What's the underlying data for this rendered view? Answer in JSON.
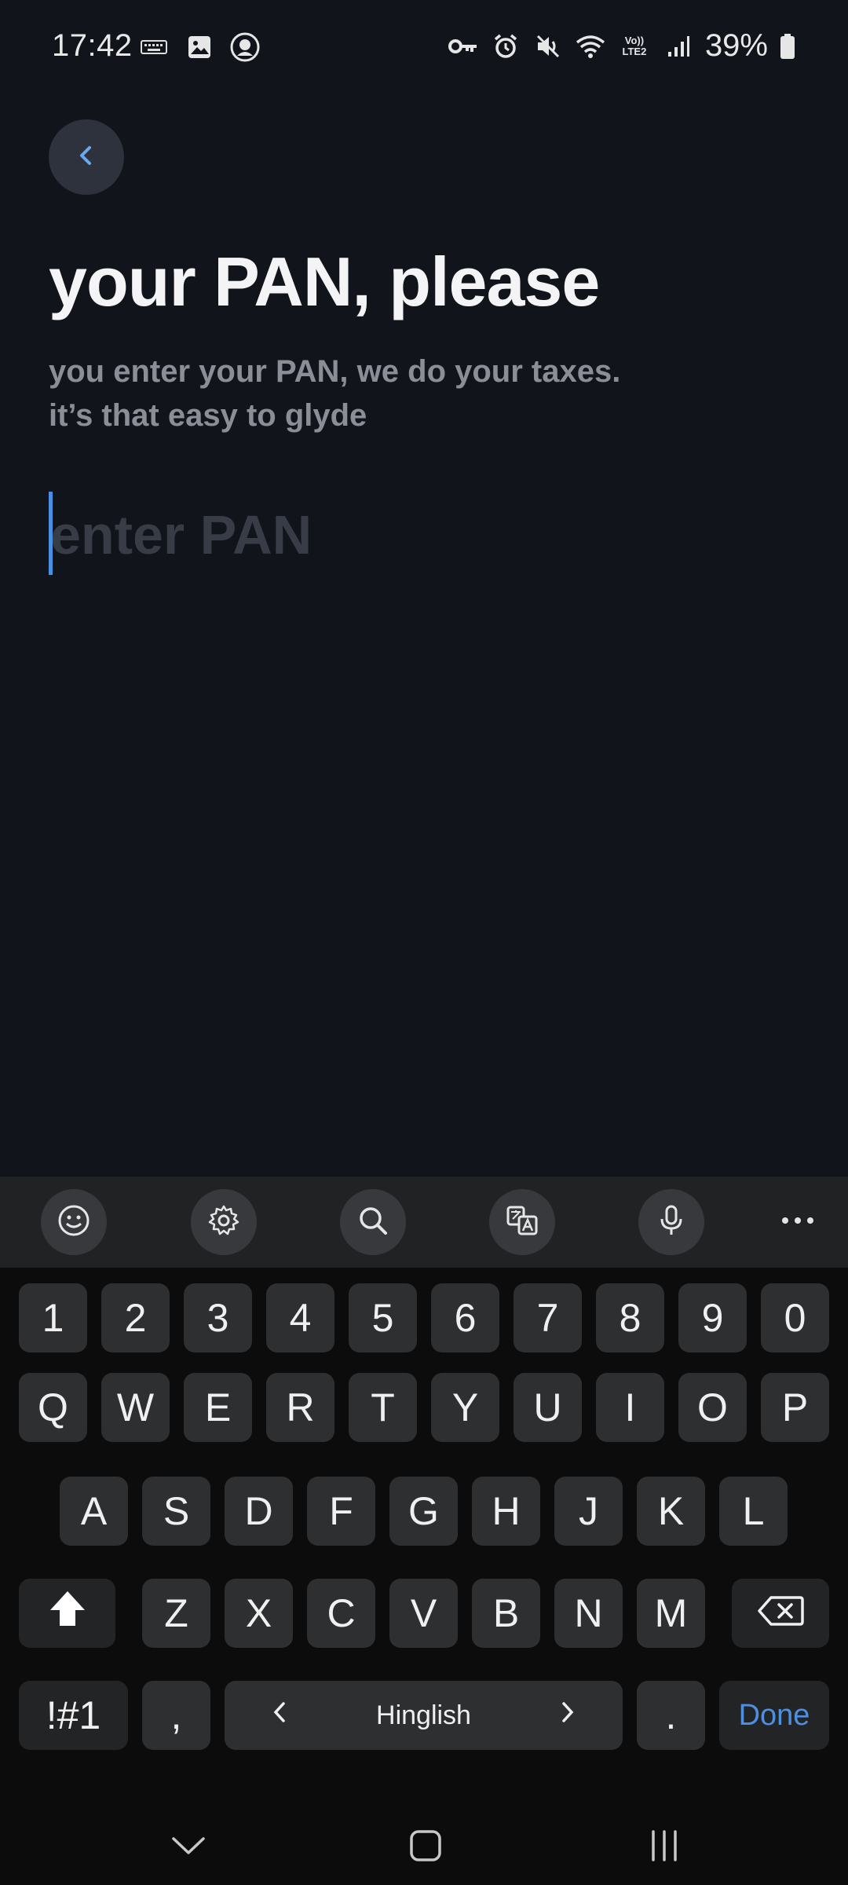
{
  "status_bar": {
    "time": "17:42",
    "battery_percent": "39%",
    "left_icons": [
      "keyboard-icon",
      "image-icon",
      "app-avatar-icon"
    ],
    "right_icons": [
      "vpn-key-icon",
      "alarm-icon",
      "mute-icon",
      "wifi-icon",
      "volte-icon",
      "signal-icon",
      "battery-icon"
    ],
    "volte_label": "Vo)) LTE2"
  },
  "header": {
    "back_icon": "chevron-left-icon",
    "title": "your PAN, please",
    "subtitle_line1": "you enter your PAN, we do your taxes.",
    "subtitle_line2": "it’s that easy to glyde"
  },
  "pan_input": {
    "placeholder": "enter PAN",
    "value": ""
  },
  "keyboard": {
    "toolbar": [
      "emoji-icon",
      "settings-icon",
      "search-icon",
      "translate-icon",
      "microphone-icon",
      "more-icon"
    ],
    "row_numbers": [
      "1",
      "2",
      "3",
      "4",
      "5",
      "6",
      "7",
      "8",
      "9",
      "0"
    ],
    "row_1": [
      "Q",
      "W",
      "E",
      "R",
      "T",
      "Y",
      "U",
      "I",
      "O",
      "P"
    ],
    "row_2": [
      "A",
      "S",
      "D",
      "F",
      "G",
      "H",
      "J",
      "K",
      "L"
    ],
    "row_3": [
      "Z",
      "X",
      "C",
      "V",
      "B",
      "N",
      "M"
    ],
    "symbols_label": "!#1",
    "comma_label": ",",
    "space_label": "Hinglish",
    "period_label": ".",
    "done_label": "Done",
    "accent_color": "#4f8fdf"
  },
  "nav_bar": {
    "icons": [
      "hide-keyboard-icon",
      "home-icon",
      "recents-icon"
    ]
  }
}
